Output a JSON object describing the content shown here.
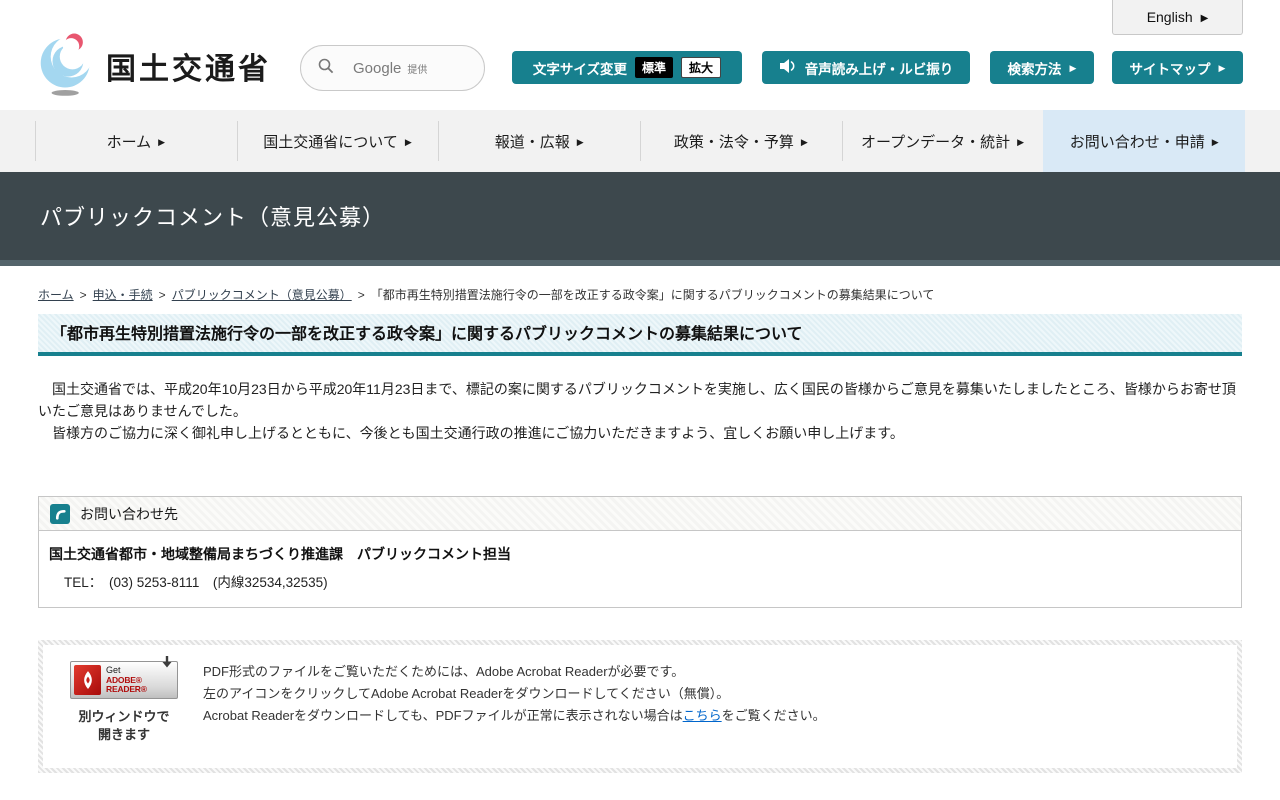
{
  "colors": {
    "accent_teal": "#17808e",
    "title_band": "#3d484d",
    "nav_active_bg": "#d9e9f6",
    "link_blue": "#0066cc",
    "adobe_red": "#b00c0c"
  },
  "header": {
    "english": {
      "label": "English",
      "arrow": "▶"
    },
    "logo_text": "国土交通省",
    "search": {
      "google": "Google",
      "provided": "提供"
    },
    "font_size": {
      "label": "文字サイズ変更",
      "standard": "標準",
      "large": "拡大"
    },
    "tts_label": "音声読み上げ・ルビ振り",
    "search_method_label": "検索方法",
    "sitemap_label": "サイトマップ"
  },
  "nav": {
    "arrow": "▶",
    "items": [
      {
        "label": "ホーム"
      },
      {
        "label": "国土交通省について"
      },
      {
        "label": "報道・広報"
      },
      {
        "label": "政策・法令・予算"
      },
      {
        "label": "オープンデータ・統計"
      },
      {
        "label": "お問い合わせ・申請"
      }
    ]
  },
  "page_title": "パブリックコメント（意見公募）",
  "breadcrumb": {
    "separator": ">",
    "links": [
      {
        "label": "ホーム"
      },
      {
        "label": "申込・手続"
      },
      {
        "label": "パブリックコメント（意見公募）"
      }
    ],
    "current": "「都市再生特別措置法施行令の一部を改正する政令案」に関するパブリックコメントの募集結果について"
  },
  "article": {
    "heading": "「都市再生特別措置法施行令の一部を改正する政令案」に関するパブリックコメントの募集結果について",
    "paragraphs": [
      "　国土交通省では、平成20年10月23日から平成20年11月23日まで、標記の案に関するパブリックコメントを実施し、広く国民の皆様からご意見を募集いたしましたところ、皆様からお寄せ頂いたご意見はありませんでした。",
      "　皆様方のご協力に深く御礼申し上げるとともに、今後とも国土交通行政の推進にご協力いただきますよう、宜しくお願い申し上げます。"
    ]
  },
  "contact": {
    "header": "お問い合わせ先",
    "department": "国土交通省都市・地域整備局まちづくり推進課　パブリックコメント担当",
    "tel": "TEL：　(03) 5253-8111　(内線32534,32535)"
  },
  "pdf_notice": {
    "badge": {
      "get": "Get",
      "reader": "ADOBE® READER®"
    },
    "badge_caption": [
      "別ウィンドウで",
      "開きます"
    ],
    "lines": [
      "PDF形式のファイルをご覧いただくためには、Adobe Acrobat Readerが必要です。",
      "左のアイコンをクリックしてAdobe Acrobat Readerをダウンロードしてください（無償）。"
    ],
    "line3": {
      "before": "Acrobat Readerをダウンロードしても、PDFファイルが正常に表示されない場合は",
      "link": "こちら",
      "after": "をご覧ください。"
    }
  }
}
